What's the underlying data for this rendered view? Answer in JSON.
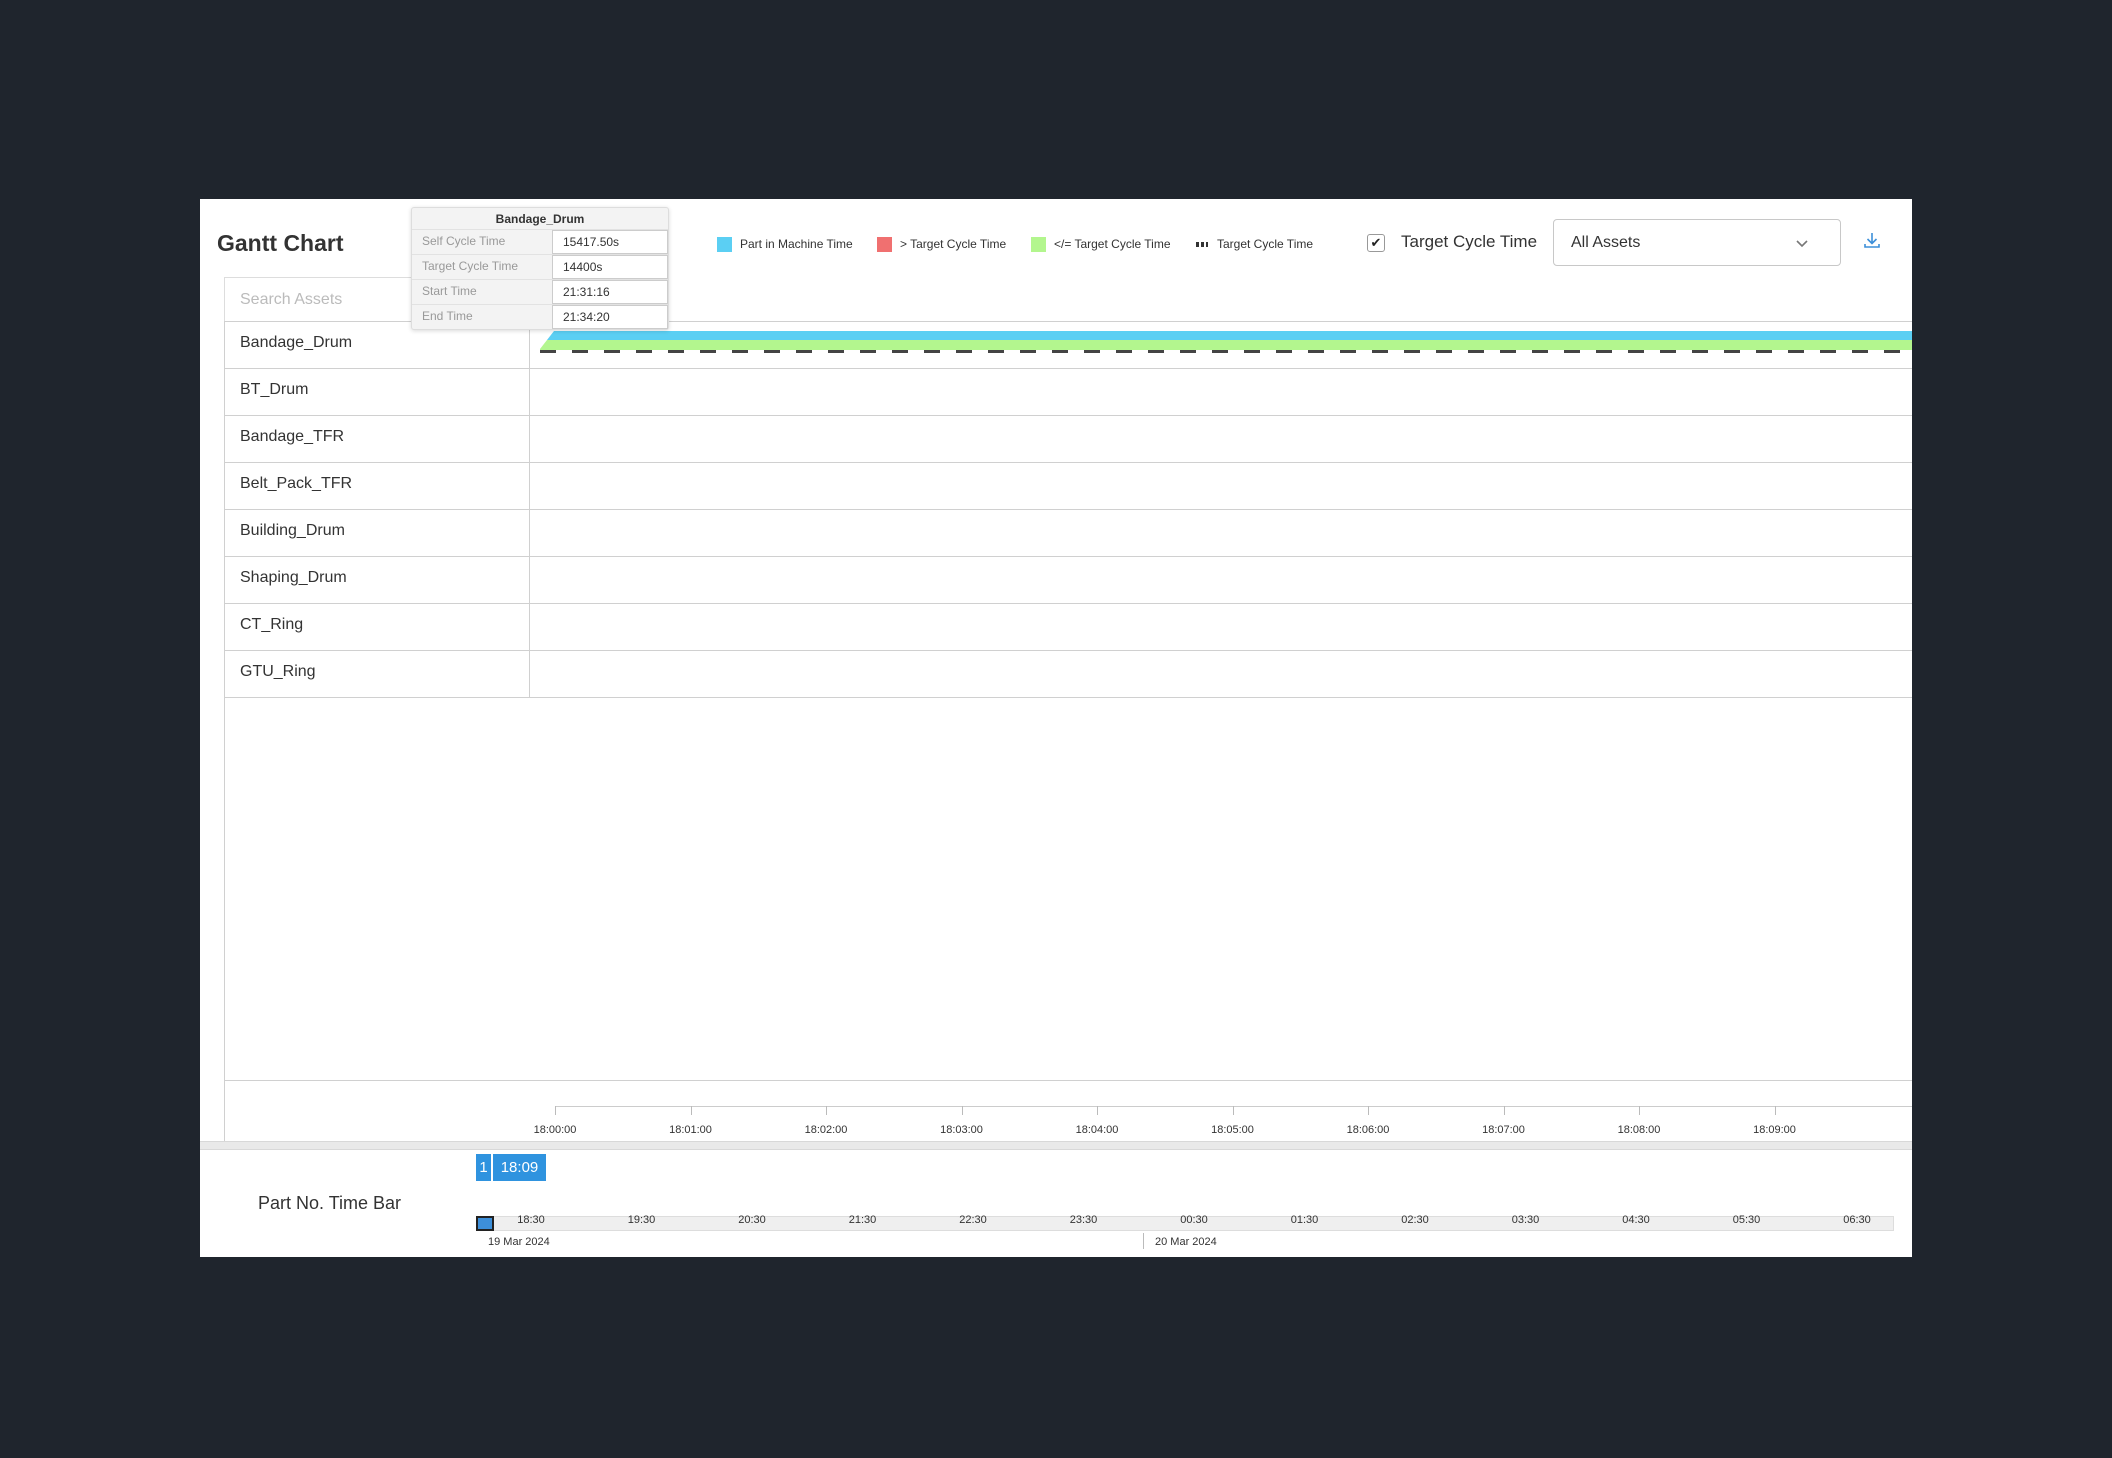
{
  "header": {
    "title": "Gantt Chart"
  },
  "legend": [
    {
      "label": "Part in Machine Time",
      "color": "#5bcff3",
      "kind": "swatch"
    },
    {
      "label": "> Target Cycle Time",
      "color": "#f07070",
      "kind": "swatch"
    },
    {
      "label": "</= Target Cycle Time",
      "color": "#b3f68e",
      "kind": "swatch"
    },
    {
      "label": "Target Cycle Time",
      "color": "#333333",
      "kind": "dash"
    }
  ],
  "controls": {
    "target_cycle_checkbox": {
      "checked": true,
      "label": "Target Cycle Time"
    },
    "asset_select": {
      "value": "All Assets"
    }
  },
  "search": {
    "placeholder": "Search Assets"
  },
  "assets": [
    "Bandage_Drum",
    "BT_Drum",
    "Bandage_TFR",
    "Belt_Pack_TFR",
    "Building_Drum",
    "Shaping_Drum",
    "CT_Ring",
    "GTU_Ring"
  ],
  "tooltip": {
    "title": "Bandage_Drum",
    "rows": [
      {
        "key": "Self Cycle Time",
        "value": "15417.50s"
      },
      {
        "key": "Target Cycle Time",
        "value": "14400s"
      },
      {
        "key": "Start Time",
        "value": "21:31:16"
      },
      {
        "key": "End Time",
        "value": "21:34:20"
      }
    ]
  },
  "axis": {
    "ticks": [
      "18:00:00",
      "18:01:00",
      "18:02:00",
      "18:03:00",
      "18:04:00",
      "18:05:00",
      "18:06:00",
      "18:07:00",
      "18:08:00",
      "18:09:00"
    ]
  },
  "timebar": {
    "title": "Part No. Time Bar",
    "selected_index": "1",
    "selected_time": "18:09",
    "ticks": [
      "18:30",
      "19:30",
      "20:30",
      "21:30",
      "22:30",
      "23:30",
      "00:30",
      "01:30",
      "02:30",
      "03:30",
      "04:30",
      "05:30",
      "06:30"
    ],
    "dates": [
      "19 Mar 2024",
      "20 Mar 2024"
    ]
  },
  "colors": {
    "in_machine": "#5bcff3",
    "over_target": "#f07070",
    "within_target": "#b3f68e",
    "accent": "#2f93df"
  }
}
